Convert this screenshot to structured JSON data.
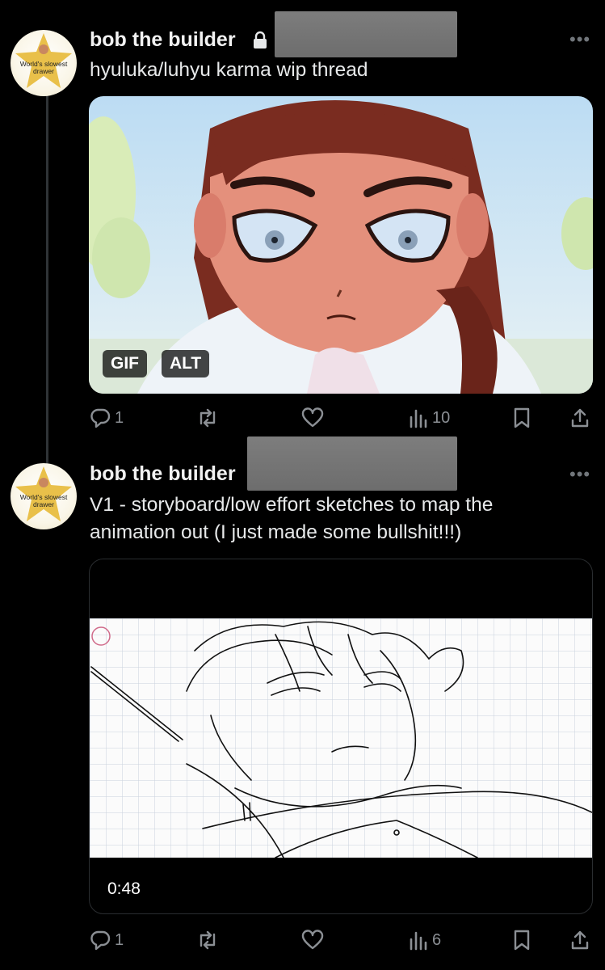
{
  "posts": [
    {
      "author": "bob the builder",
      "text": "hyuluka/luhyu karma wip thread",
      "avatar_caption": "World's slowest drawer",
      "media_badges": [
        "GIF",
        "ALT"
      ],
      "replies": "1",
      "views": "10",
      "locked": true
    },
    {
      "author": "bob the builder",
      "text": "V1 - storyboard/low effort sketches to map the animation out (I just made some bullshit!!!)",
      "avatar_caption": "World's slowest drawer",
      "video_duration": "0:48",
      "replies": "1",
      "views": "6"
    }
  ],
  "icons": [
    "lock-icon",
    "more-icon",
    "reply-icon",
    "retweet-icon",
    "like-icon",
    "views-icon",
    "bookmark-icon",
    "share-icon"
  ],
  "colors": {
    "background": "#000000",
    "text": "#e7e9ea",
    "muted": "#8b8f94",
    "redaction": "#757575"
  }
}
